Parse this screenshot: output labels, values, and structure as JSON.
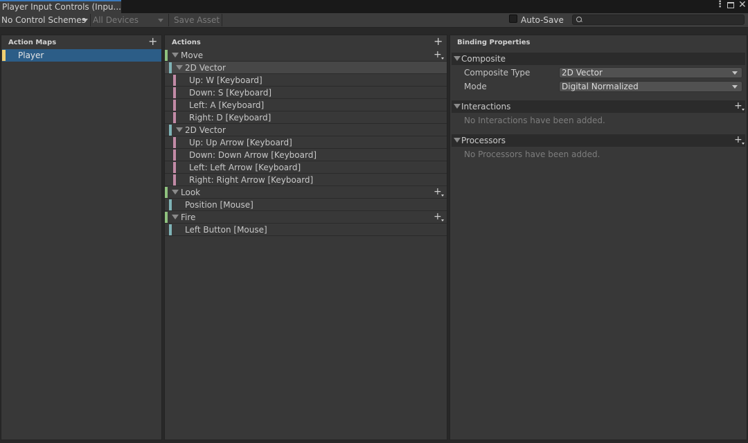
{
  "window": {
    "tab_title": "Player Input Controls (Inpu...",
    "menu_icon": "kebab-menu-icon",
    "maximize_icon": "maximize-icon",
    "close_icon": "close-icon"
  },
  "toolbar": {
    "control_schemes": "No Control Schemes",
    "devices": "All Devices",
    "save_asset": "Save Asset",
    "auto_save_label": "Auto-Save",
    "auto_save_checked": false,
    "search_placeholder": "",
    "search_icon": "search-icon"
  },
  "action_maps": {
    "title": "Action Maps",
    "items": [
      {
        "label": "Player",
        "selected": true,
        "color": "#f0cf72"
      }
    ]
  },
  "actions": {
    "title": "Actions",
    "rows": [
      {
        "type": "action",
        "label": "Move",
        "color": "#8fc27f",
        "add": true
      },
      {
        "type": "composite",
        "label": "2D Vector",
        "color": "#7fb3b6",
        "selected": true
      },
      {
        "type": "part",
        "label": "Up: W [Keyboard]",
        "color": "#c28aa6"
      },
      {
        "type": "part",
        "label": "Down: S [Keyboard]",
        "color": "#c28aa6"
      },
      {
        "type": "part",
        "label": "Left: A [Keyboard]",
        "color": "#c28aa6"
      },
      {
        "type": "part",
        "label": "Right: D [Keyboard]",
        "color": "#c28aa6"
      },
      {
        "type": "composite",
        "label": "2D Vector",
        "color": "#7fb3b6"
      },
      {
        "type": "part",
        "label": "Up: Up Arrow [Keyboard]",
        "color": "#c28aa6"
      },
      {
        "type": "part",
        "label": "Down: Down Arrow [Keyboard]",
        "color": "#c28aa6"
      },
      {
        "type": "part",
        "label": "Left: Left Arrow [Keyboard]",
        "color": "#c28aa6"
      },
      {
        "type": "part",
        "label": "Right: Right Arrow [Keyboard]",
        "color": "#c28aa6"
      },
      {
        "type": "action",
        "label": "Look",
        "color": "#8fc27f",
        "add": true
      },
      {
        "type": "binding",
        "label": "Position [Mouse]",
        "color": "#7fb3b6"
      },
      {
        "type": "action",
        "label": "Fire",
        "color": "#8fc27f",
        "add": true
      },
      {
        "type": "binding",
        "label": "Left Button [Mouse]",
        "color": "#7fb3b6"
      }
    ]
  },
  "binding_properties": {
    "title": "Binding Properties",
    "composite": {
      "header": "Composite",
      "type_label": "Composite Type",
      "type_value": "2D Vector",
      "mode_label": "Mode",
      "mode_value": "Digital Normalized"
    },
    "interactions": {
      "header": "Interactions",
      "empty_text": "No Interactions have been added."
    },
    "processors": {
      "header": "Processors",
      "empty_text": "No Processors have been added."
    }
  }
}
